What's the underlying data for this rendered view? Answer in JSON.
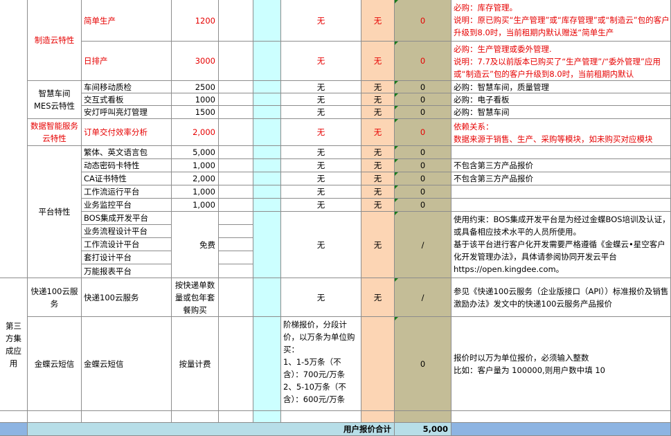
{
  "sections": {
    "manufacturing": "制造云特性",
    "smart_workshop": "智慧车间\nMES云特性",
    "data_service": "数据智能服务\n云特性",
    "platform": "平台特性",
    "third_party": "第三\n方集\n成应\n用",
    "express": "快递100云服\n务",
    "sms": "金蝶云短信"
  },
  "rows": [
    {
      "item": "简单生产",
      "price": "1200",
      "c5": "无",
      "c6": "无",
      "c7": "0",
      "note": "必购：库存管理。\n说明：原已购买“生产管理”或“库存管理”或“制造云”包的客户升级到8.0时，当前租期内默认赠送“简单生产"
    },
    {
      "item": "日排产",
      "price": "3000",
      "c5": "无",
      "c6": "无",
      "c7": "0",
      "note": "必购：生产管理或委外管理.\n说明：7.7及以前版本已购买了“生产管理”/“委外管理”应用或“制造云”包的客户升级到8.0时，当前租期内默认"
    },
    {
      "item": "车间移动质检",
      "price": "2500",
      "c5": "无",
      "c6": "无",
      "c7": "0",
      "note": "必购：智慧车间，质量管理"
    },
    {
      "item": "交互式看板",
      "price": "1000",
      "c5": "无",
      "c6": "无",
      "c7": "0",
      "note": "必购：电子看板"
    },
    {
      "item": "安灯呼叫亮灯管理",
      "price": "1500",
      "c5": "无",
      "c6": "无",
      "c7": "0",
      "note": "必购：智慧车间"
    },
    {
      "item": "订单交付效率分析",
      "price": "2,000",
      "c5": "无",
      "c6": "无",
      "c7": "0",
      "note": "依赖关系：\n数据来源于销售、生产、采购等模块，如未购买对应模块"
    },
    {
      "item": "繁体、英文语言包",
      "price": "5,000",
      "c5": "无",
      "c6": "无",
      "c7": "0",
      "note": ""
    },
    {
      "item": "动态密码卡特性",
      "price": "1,000",
      "c5": "无",
      "c6": "无",
      "c7": "0",
      "note": "不包含第三方产品报价"
    },
    {
      "item": "CA证书特性",
      "price": "2,000",
      "c5": "无",
      "c6": "无",
      "c7": "0",
      "note": "不包含第三方产品报价"
    },
    {
      "item": "工作流运行平台",
      "price": "1,000",
      "c5": "无",
      "c6": "无",
      "c7": "0",
      "note": ""
    },
    {
      "item": "业务监控平台",
      "price": "1,000",
      "c5": "无",
      "c6": "无",
      "c7": "0",
      "note": ""
    }
  ],
  "bos_items": [
    "BOS集成开发平台",
    "业务流程设计平台",
    "工作流设计平台",
    "套打设计平台",
    "万能报表平台"
  ],
  "bos": {
    "price": "免费",
    "c5": "无",
    "c6": "无",
    "c7": "/",
    "note": "使用约束：BOS集成开发平台是为经过金蝶BOS培训及认证，或具备相应技术水平的人员所使用。\n基于该平台进行客户化开发需要严格遵循《金蝶云•星空客户化开发管理办法》，具体请参阅协同开发云平台https://open.kingdee.com。"
  },
  "express_row": {
    "item": "快递100云服务",
    "price": "按快递单数\n量或包年套\n餐购买",
    "c5": "无",
    "c6": "无",
    "c7": "/",
    "note": "参见《快递100云服务（企业版接口（API））标准报价及销售激励办法》发文中的快递100云服务产品报价"
  },
  "sms_row": {
    "item": "金蝶云短信",
    "price": "按量计费",
    "c5": "阶梯报价，分段计价，以万条为单位购买：\n1、1-5万条（不含）：700元/万条\n2、5-10万条（不含）：600元/万条",
    "c7": "0",
    "note": "报价时以万为单位报价，必须输入整数\n比如：客户量为 100000,则用户数中填 10"
  },
  "footer": {
    "label": "用户报价合计",
    "total": "5,000"
  },
  "colors": {
    "red": "#e60000",
    "cyan": "#ccffff",
    "peach": "#fcd5b4",
    "khaki": "#c4bd97",
    "footer": "#8db4e2"
  }
}
